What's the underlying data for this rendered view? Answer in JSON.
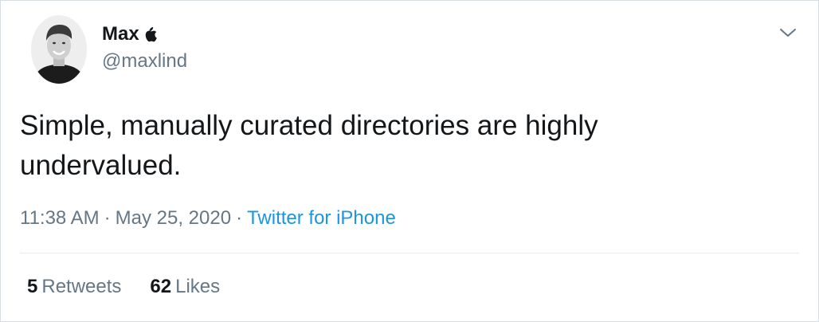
{
  "tweet": {
    "author": {
      "display_name": "Max",
      "verified_glyph_icon": "apple-logo-icon",
      "handle": "@maxlind"
    },
    "menu_icon": "chevron-down-icon",
    "text_line_1": "Simple, manually curated directories are highly",
    "text_line_2": "undervalued.",
    "time": "11:38 AM",
    "separator": "·",
    "date": "May 25, 2020",
    "source": "Twitter for iPhone",
    "stats": {
      "retweets_count": "5",
      "retweets_label": "Retweets",
      "likes_count": "62",
      "likes_label": "Likes"
    }
  },
  "colors": {
    "text_primary": "#14171a",
    "text_secondary": "#657786",
    "link": "#1b95e0",
    "border": "#d8dde1"
  }
}
